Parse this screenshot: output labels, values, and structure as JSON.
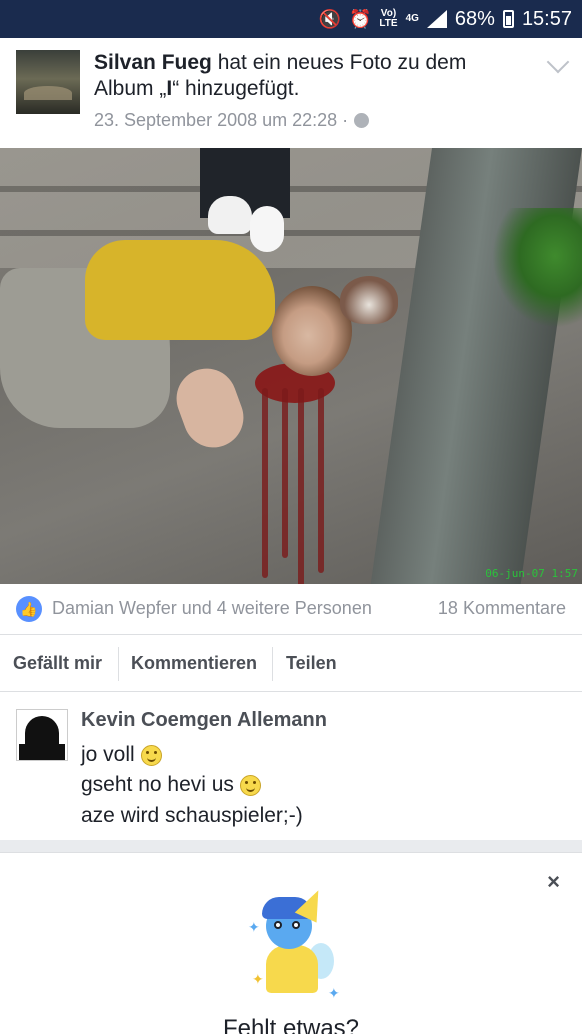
{
  "statusbar": {
    "volte": "Vo)",
    "lte": "LTE",
    "network": "4G",
    "battery": "68%",
    "time": "15:57"
  },
  "post": {
    "author": "Silvan Fueg",
    "action": " hat ein neues Foto zu dem Album „",
    "album": "I",
    "action_end": "“ hinzugefügt.",
    "date": "23. September 2008 um 22:28 ·",
    "photo_stamp": "06-jun-07 1:57"
  },
  "reactions": {
    "names": "Damian Wepfer und 4 weitere Personen",
    "comments": "18 Kommentare"
  },
  "actions": {
    "like": "Gefällt mir",
    "comment": "Kommentieren",
    "share": "Teilen"
  },
  "comment": {
    "author": "Kevin Coemgen Allemann",
    "line1": "jo voll",
    "line2": "gseht no hevi us",
    "line3": "aze wird schauspieler;-)"
  },
  "card": {
    "close": "×",
    "prompt": "Fehlt etwas?"
  }
}
